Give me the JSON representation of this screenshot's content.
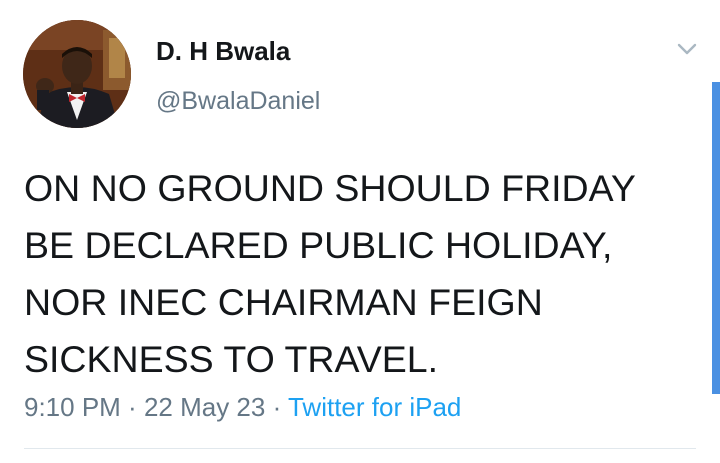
{
  "author": {
    "display_name": "D. H Bwala",
    "handle": "@BwalaDaniel",
    "avatar_icon": "profile-photo"
  },
  "menu": {
    "icon": "chevron-down-icon"
  },
  "tweet": {
    "lines": [
      "ON NO GROUND SHOULD FRIDAY",
      "BE DECLARED PUBLIC HOLIDAY,",
      "NOR INEC CHAIRMAN FEIGN",
      "SICKNESS TO TRAVEL."
    ]
  },
  "meta": {
    "time": "9:10 PM",
    "separator1": " · ",
    "date": "22 May 23",
    "separator2": " · ",
    "source": "Twitter for iPad"
  },
  "colors": {
    "text": "#14171a",
    "secondary": "#657786",
    "link": "#1da1f2",
    "scrollbar": "#4a90e2"
  }
}
